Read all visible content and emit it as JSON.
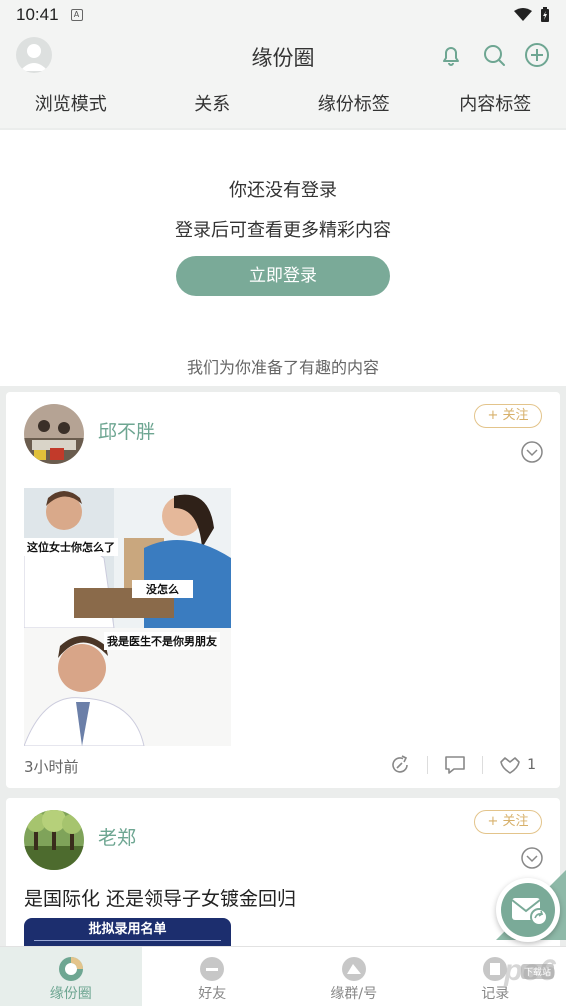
{
  "status_bar": {
    "time": "10:41",
    "notification_glyph": "A"
  },
  "header": {
    "title": "缘份圈"
  },
  "filters": [
    "浏览模式",
    "关系",
    "缘份标签",
    "内容标签"
  ],
  "login": {
    "title": "你还没有登录",
    "subtitle": "登录后可查看更多精彩内容",
    "button_label": "立即登录",
    "recommend_note": "我们为你准备了有趣的内容"
  },
  "posts": [
    {
      "author": "邱不胖",
      "follow_label": "+ 关注",
      "meme_captions": [
        "这位女士你怎么了",
        "没怎么",
        "我是医生不是你男朋友"
      ],
      "time": "3小时前",
      "like_count": "1"
    },
    {
      "author": "老郑",
      "follow_label": "+ 关注",
      "text": "是国际化 还是领导子女镀金回归",
      "image_banner": "批拟录用名单"
    }
  ],
  "bottom_nav": [
    {
      "label": "缘份圈",
      "icon": "circle-icon",
      "active": true
    },
    {
      "label": "好友",
      "icon": "friends-icon",
      "active": false
    },
    {
      "label": "缘群/号",
      "icon": "group-icon",
      "active": false
    },
    {
      "label": "记录",
      "icon": "record-icon",
      "active": false
    }
  ],
  "watermark": {
    "text": "pc6",
    "tag": "下载站"
  },
  "colors": {
    "accent": "#7aaa98",
    "author": "#6ea692",
    "follow": "#d7b06a"
  }
}
